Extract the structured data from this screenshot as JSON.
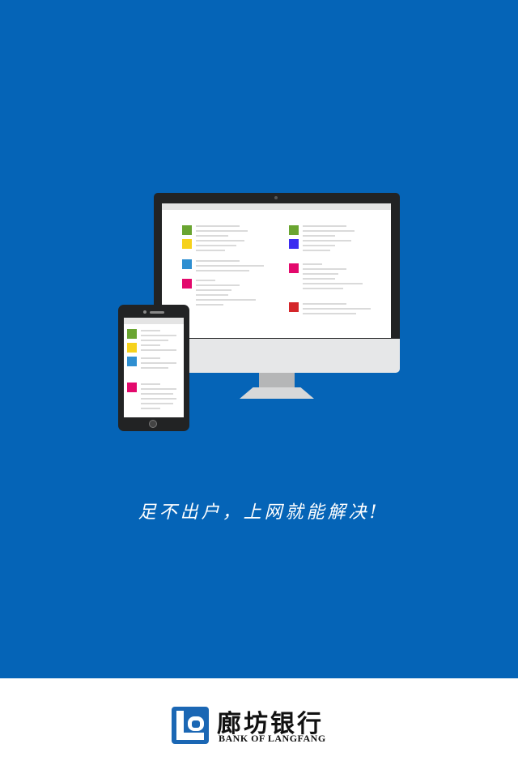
{
  "splash": {
    "slogan": "足不出户，上网就能解决!",
    "background_color": "#0564b7"
  },
  "footer": {
    "bank_name_cn": "廊坊银行",
    "bank_name_en": "BANK OF LANGFANG",
    "logo_icon": "bank-logo-icon"
  },
  "colors": {
    "green": "#6aa531",
    "yellow": "#f6d21c",
    "blue": "#2f8fd1",
    "magenta": "#e3096c",
    "indigo": "#3c2cf0",
    "red": "#d4262a"
  }
}
